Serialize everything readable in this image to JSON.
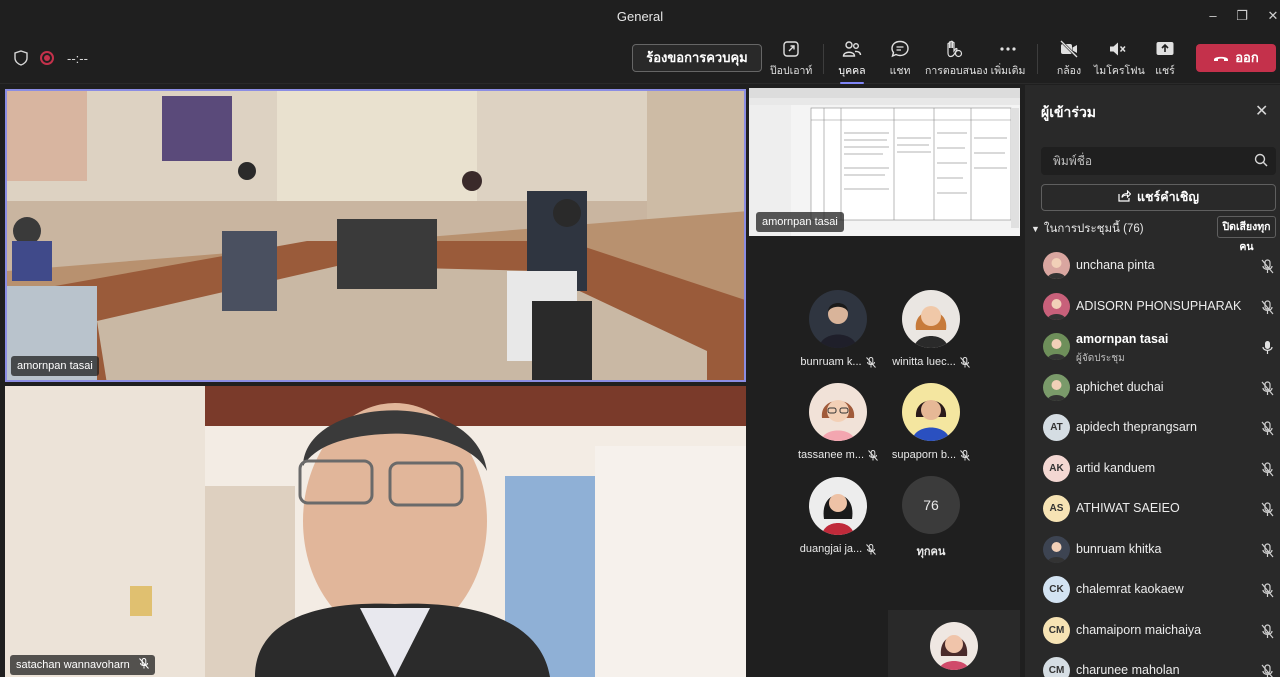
{
  "window": {
    "title": "General",
    "controls": {
      "minimize": "–",
      "maximize": "❐",
      "close": "✕"
    }
  },
  "toolbar": {
    "timer": "--:--",
    "request_control": "ร้องขอการควบคุม",
    "tools": {
      "popout": "ป๊อปเอาท์",
      "people": "บุคคล",
      "chat": "แชท",
      "react": "การตอบสนอง",
      "more": "เพิ่มเติม",
      "camera": "กล้อง",
      "mic": "ไมโครโฟน",
      "share": "แชร์"
    },
    "leave": "ออก"
  },
  "stage": {
    "room_video_name": "amornpan tasai",
    "face_video_name": "satachan wannavoharn",
    "screen_share_name": "amornpan tasai",
    "grid": [
      {
        "name": "bunruam k...",
        "muted": true
      },
      {
        "name": "winitta luec...",
        "muted": true
      },
      {
        "name": "tassanee m...",
        "muted": true
      },
      {
        "name": "supaporn b...",
        "muted": true
      },
      {
        "name": "duangjai ja...",
        "muted": true
      }
    ],
    "all_count": "76",
    "all_label": "ทุกคน"
  },
  "panel": {
    "title": "ผู้เข้าร่วม",
    "search_placeholder": "พิมพ์ชื่อ",
    "share_invite": "แชร์คำเชิญ",
    "section_label": "ในการประชุมนี้ (76)",
    "mute_all": "ปิดเสียงทุกคน",
    "participants": [
      {
        "name": "unchana pinta",
        "initials": "",
        "role": "",
        "muted": true,
        "avatar_color": "#d9a6a0"
      },
      {
        "name": "ADISORN PHONSUPHARAK",
        "initials": "",
        "role": "",
        "muted": true,
        "avatar_color": "#c8607a"
      },
      {
        "name": "amornpan tasai",
        "initials": "",
        "role": "ผู้จัดประชุม",
        "muted": false,
        "avatar_color": "#6e8f5a"
      },
      {
        "name": "aphichet duchai",
        "initials": "",
        "role": "",
        "muted": true,
        "avatar_color": "#7a9a6a"
      },
      {
        "name": "apidech theprangsarn",
        "initials": "AT",
        "role": "",
        "muted": true,
        "avatar_color": "#d5dde3"
      },
      {
        "name": "artid kanduem",
        "initials": "AK",
        "role": "",
        "muted": true,
        "avatar_color": "#f3d7d2"
      },
      {
        "name": "ATHIWAT SAEIEO",
        "initials": "AS",
        "role": "",
        "muted": true,
        "avatar_color": "#f6e3b4"
      },
      {
        "name": "bunruam khitka",
        "initials": "",
        "role": "",
        "muted": true,
        "avatar_color": "#3d4452"
      },
      {
        "name": "chalemrat kaokaew",
        "initials": "CK",
        "role": "",
        "muted": true,
        "avatar_color": "#d3e3f2"
      },
      {
        "name": "chamaiporn maichaiya",
        "initials": "CM",
        "role": "",
        "muted": true,
        "avatar_color": "#f6e3b4"
      },
      {
        "name": "charunee maholan",
        "initials": "CM",
        "role": "",
        "muted": true,
        "avatar_color": "#d5dde3"
      }
    ]
  }
}
